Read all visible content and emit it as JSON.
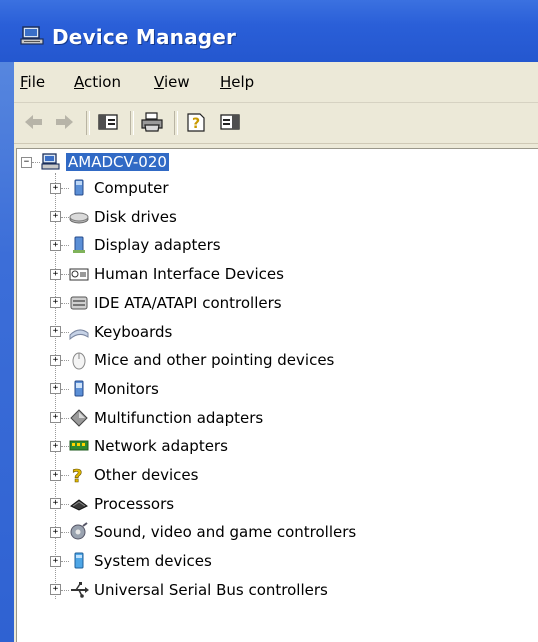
{
  "window": {
    "title": "Device Manager"
  },
  "menu": [
    {
      "label": "File",
      "accel": "F",
      "rest": "ile"
    },
    {
      "label": "Action",
      "accel": "A",
      "rest": "ction"
    },
    {
      "label": "View",
      "accel": "V",
      "rest": "iew"
    },
    {
      "label": "Help",
      "accel": "H",
      "rest": "elp"
    }
  ],
  "toolbar": {
    "buttons": [
      "back-arrow-icon",
      "forward-arrow-icon",
      "show-hide-console-tree-icon",
      "print-icon",
      "help-icon",
      "properties-pane-icon"
    ]
  },
  "tree": {
    "root": "AMADCV-020",
    "expander_collapsed": "+",
    "expander_expanded": "−",
    "items": [
      {
        "label": "Computer",
        "icon": "computer-icon"
      },
      {
        "label": "Disk drives",
        "icon": "disk-drive-icon"
      },
      {
        "label": "Display adapters",
        "icon": "display-adapter-icon"
      },
      {
        "label": "Human Interface Devices",
        "icon": "hid-icon"
      },
      {
        "label": "IDE ATA/ATAPI controllers",
        "icon": "ide-controller-icon"
      },
      {
        "label": "Keyboards",
        "icon": "keyboard-icon"
      },
      {
        "label": "Mice and other pointing devices",
        "icon": "mouse-icon"
      },
      {
        "label": "Monitors",
        "icon": "monitor-icon"
      },
      {
        "label": "Multifunction adapters",
        "icon": "multifunction-icon"
      },
      {
        "label": "Network adapters",
        "icon": "network-adapter-icon"
      },
      {
        "label": "Other devices",
        "icon": "unknown-device-icon"
      },
      {
        "label": "Processors",
        "icon": "processor-icon"
      },
      {
        "label": "Sound, video and game controllers",
        "icon": "sound-icon"
      },
      {
        "label": "System devices",
        "icon": "system-device-icon"
      },
      {
        "label": "Universal Serial Bus controllers",
        "icon": "usb-icon"
      }
    ]
  }
}
